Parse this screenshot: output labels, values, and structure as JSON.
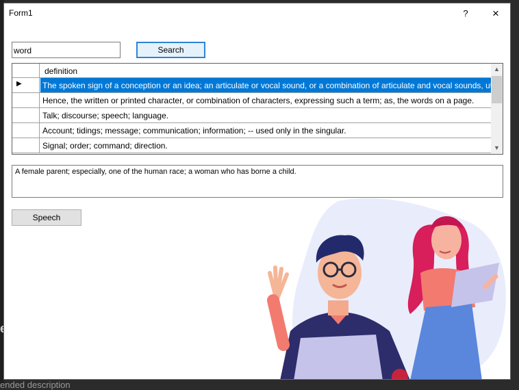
{
  "background": {
    "bottom_text": "ended description",
    "left_glyph": "e"
  },
  "window": {
    "title": "Form1",
    "help_label": "?",
    "close_label": "×"
  },
  "search": {
    "value": "word",
    "button_label": "Search"
  },
  "grid": {
    "column_header": "definition",
    "selected_row_marker": "▶",
    "rows": [
      "The spoken sign of a conception or an idea; an articulate or   vocal sound, or a combination of articulate and vocal sounds, uttered   by ...",
      "Hence, the written or printed character, or combination of   characters, expressing such a term; as, the words on a page.",
      "Talk; discourse; speech; language.",
      "Account; tidings; message; communication; information; --   used only in the singular.",
      "Signal; order; command; direction."
    ],
    "scroll_up_icon": "▲",
    "scroll_down_icon": "▼"
  },
  "detail": {
    "text": "A female parent; especially, one of the human race; a woman   who has borne a child."
  },
  "speech": {
    "button_label": "Speech"
  },
  "colors": {
    "selection": "#0078d7",
    "search_button_border": "#2f84d6",
    "illustration_blob": "#e9ecfb"
  }
}
